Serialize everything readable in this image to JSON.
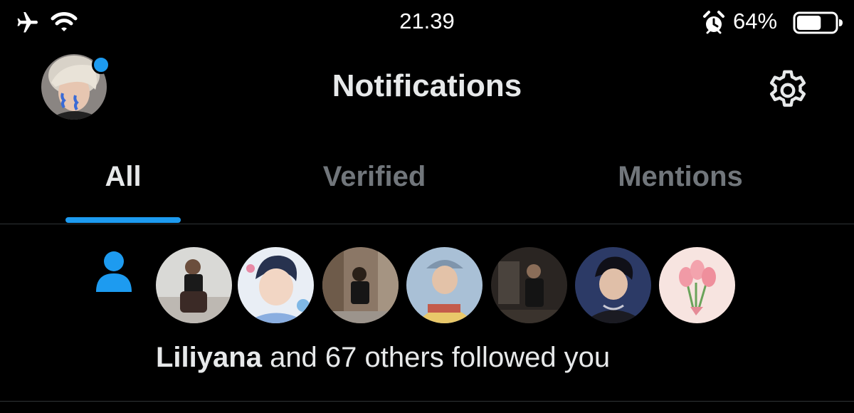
{
  "status_bar": {
    "time": "21.39",
    "battery_percent": "64%",
    "battery_level": 0.64,
    "icons": [
      "airplane-icon",
      "wifi-icon",
      "alarm-icon",
      "battery-icon"
    ]
  },
  "header": {
    "title": "Notifications",
    "has_unread_dot": true,
    "icons": [
      "avatar",
      "gear-icon"
    ]
  },
  "tabs": [
    {
      "label": "All",
      "active": true
    },
    {
      "label": "Verified",
      "active": false
    },
    {
      "label": "Mentions",
      "active": false
    }
  ],
  "colors": {
    "accent": "#1d9bf0",
    "background": "#000000",
    "primary_text": "#e7e9ea",
    "muted_text": "#71767b",
    "divider": "#2f3336"
  },
  "notification": {
    "icon": "person-icon",
    "name": "Liliyana",
    "rest": " and 67 others followed you",
    "follower_avatar_count": 7
  }
}
